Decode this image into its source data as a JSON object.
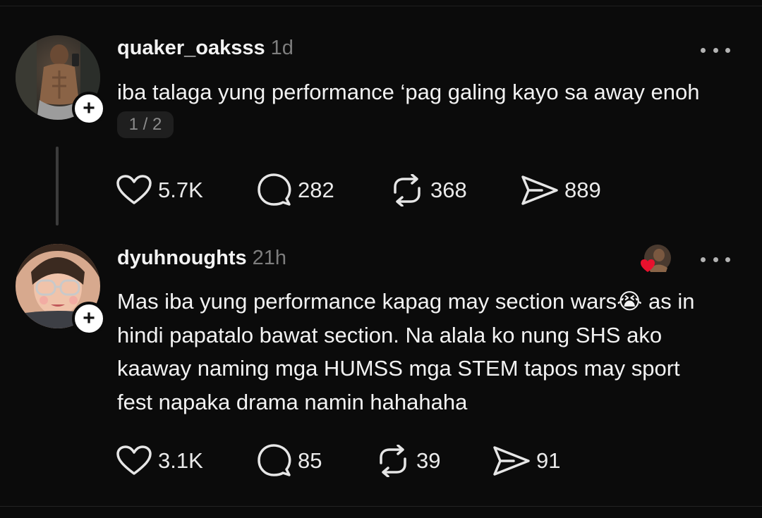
{
  "posts": [
    {
      "username": "quaker_oaksss",
      "time": "1d",
      "text_lines": [
        "iba talaga yung performance ‘pag galing kayo sa away enoh"
      ],
      "pager": "1 / 2",
      "actions": {
        "likes": "5.7K",
        "replies": "282",
        "reposts": "368",
        "shares": "889"
      }
    },
    {
      "username": "dyuhnoughts",
      "time": "21h",
      "text_lines": [
        "Mas iba yung performance kapag may section wars😭 as in",
        "hindi papatalo bawat section. Na alala ko nung SHS ako",
        "kaaway naming mga HUMSS mga STEM tapos may sport",
        "fest napaka drama namin hahahaha"
      ],
      "actions": {
        "likes": "3.1K",
        "replies": "85",
        "reposts": "39",
        "shares": "91"
      }
    }
  ],
  "icons": {
    "follow": "plus-icon",
    "more": "more-dots-icon",
    "like": "heart-icon",
    "reply": "comment-icon",
    "repost": "repost-icon",
    "share": "send-icon",
    "liked_by": "heart-red-icon"
  },
  "colors": {
    "background": "#0b0b0b",
    "text": "#f2f2f2",
    "muted": "#7d7d7d",
    "heart": "#e8112d"
  }
}
